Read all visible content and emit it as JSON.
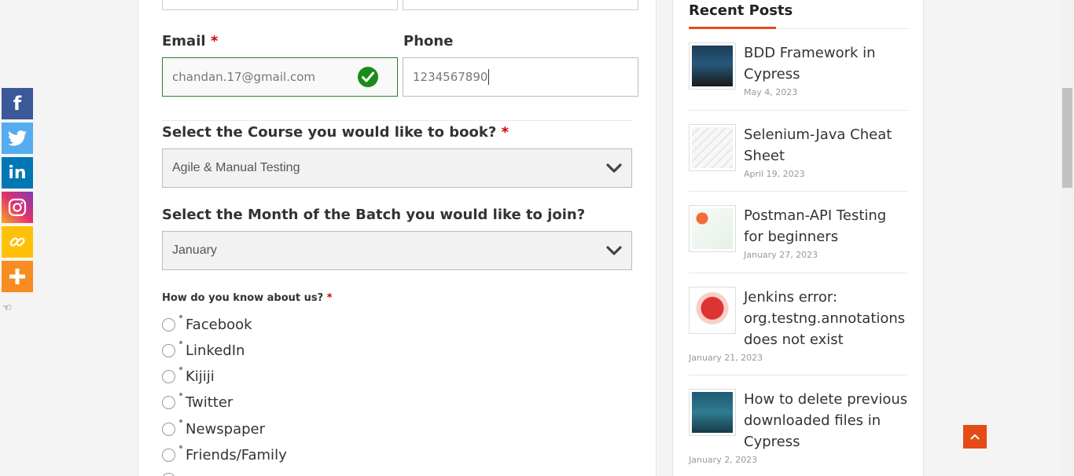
{
  "form": {
    "email_label": "Email",
    "phone_label": "Phone",
    "required_mark": "*",
    "email_value": "chandan.17@gmail.com",
    "phone_value": "1234567890",
    "course_label": "Select the Course you would like to book?",
    "course_selected": "Agile & Manual Testing",
    "month_label": "Select the Month of the Batch you would like to join?",
    "month_selected": "January",
    "source_label": "How do you know about us?",
    "source_options": [
      "Facebook",
      "LinkedIn",
      "Kijiji",
      "Twitter",
      "Newspaper",
      "Friends/Family"
    ]
  },
  "share_bar": {
    "buttons": [
      {
        "name": "facebook",
        "icon": "facebook-icon",
        "color": "#3b5998"
      },
      {
        "name": "twitter",
        "icon": "twitter-icon",
        "color": "#55acee"
      },
      {
        "name": "linkedin",
        "icon": "linkedin-icon",
        "color": "#0077b5"
      },
      {
        "name": "instagram",
        "icon": "instagram-icon",
        "color": "#c13584"
      },
      {
        "name": "copy-link",
        "icon": "link-icon",
        "color": "#ffc107"
      },
      {
        "name": "more",
        "icon": "plus-icon",
        "color": "#f78c22"
      }
    ]
  },
  "sidebar": {
    "title": "Recent Posts",
    "posts": [
      {
        "title": "BDD Framework in Cypress",
        "date": "May 4, 2023"
      },
      {
        "title": "Selenium-Java Cheat Sheet",
        "date": "April 19, 2023"
      },
      {
        "title": "Postman-API Testing for beginners",
        "date": "January 27, 2023"
      },
      {
        "title": "Jenkins error: org.testng.annotations does not exist",
        "date": "January 21, 2023"
      },
      {
        "title": "How to delete previous downloaded files in Cypress",
        "date": "January 2, 2023"
      }
    ]
  },
  "colors": {
    "accent": "#e64a19",
    "valid": "#1b8a1b",
    "required": "#cc0000"
  }
}
